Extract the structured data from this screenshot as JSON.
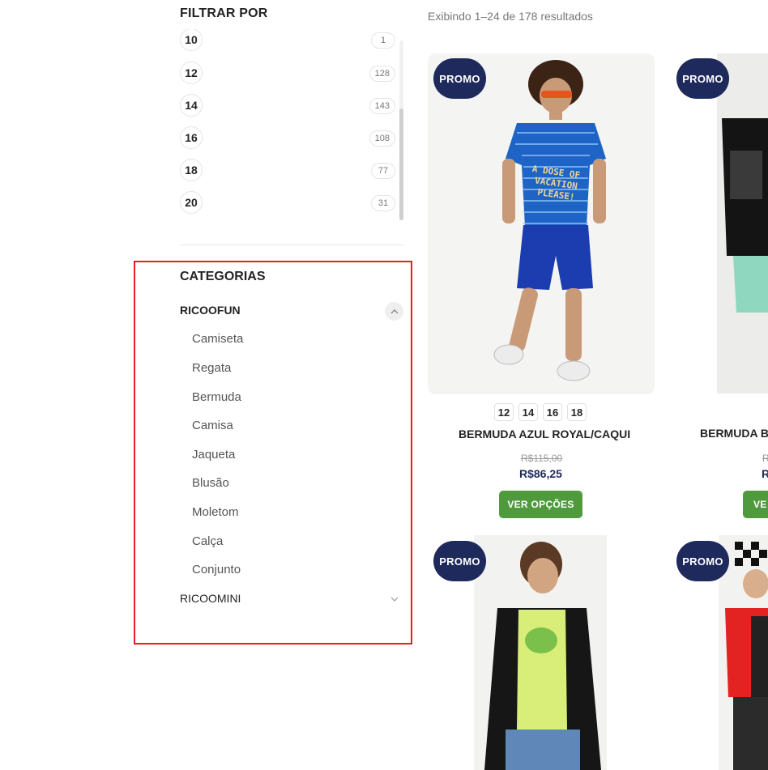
{
  "sidebar": {
    "filter_title": "FILTRAR POR",
    "sizes": [
      {
        "label": "10",
        "count": "1"
      },
      {
        "label": "12",
        "count": "128"
      },
      {
        "label": "14",
        "count": "143"
      },
      {
        "label": "16",
        "count": "108"
      },
      {
        "label": "18",
        "count": "77"
      },
      {
        "label": "20",
        "count": "31"
      }
    ],
    "categories_title": "CATEGORIAS",
    "categories": [
      {
        "label": "RICOOFUN",
        "expanded": true,
        "children": [
          "Camiseta",
          "Regata",
          "Bermuda",
          "Camisa",
          "Jaqueta",
          "Blusão",
          "Moletom",
          "Calça",
          "Conjunto"
        ]
      },
      {
        "label": "RICOOMINI",
        "expanded": false
      }
    ],
    "highlight_color": "#e31e24"
  },
  "main": {
    "result_count": "Exibindo 1–24 de 178 resultados",
    "products": [
      {
        "badge": "PROMO",
        "variants": [
          "12",
          "14",
          "16",
          "18"
        ],
        "name": "BERMUDA AZUL ROYAL/CAQUI",
        "old_price": "R$115,00",
        "price": "R$86,25",
        "button": "VER OPÇÕES"
      },
      {
        "badge": "PROMO",
        "name": "BERMUDA BE",
        "old_price": "R",
        "price": "R",
        "button": "VE"
      },
      {
        "badge": "PROMO"
      },
      {
        "badge": "PROMO"
      }
    ],
    "print_text": "A DOSE OF VACATION PLEASE!"
  },
  "colors": {
    "badge": "#1f2a5c",
    "button": "#4f9a3d",
    "price": "#1f2a5c"
  }
}
